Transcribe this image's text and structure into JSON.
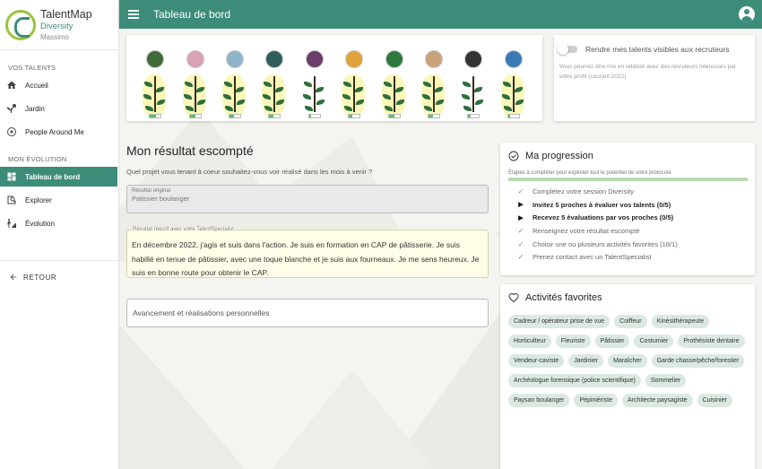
{
  "brand": {
    "name": "TalentMap",
    "sub": "Diversity",
    "user": "Massimo"
  },
  "sidebar": {
    "section1": "VOS TALENTS",
    "talents": [
      {
        "label": "Accueil",
        "icon": "home-icon"
      },
      {
        "label": "Jardin",
        "icon": "garden-icon"
      },
      {
        "label": "People Around Me",
        "icon": "target-icon"
      }
    ],
    "section2": "MON ÉVOLUTION",
    "evolution": [
      {
        "label": "Tableau de bord",
        "icon": "dashboard-icon",
        "active": true
      },
      {
        "label": "Explorer",
        "icon": "explore-icon"
      },
      {
        "label": "Évolution",
        "icon": "evolution-icon"
      }
    ],
    "back": "RETOUR"
  },
  "topbar": {
    "title": "Tableau de bord"
  },
  "colors": {
    "primary": "#3d8c7a",
    "chip": "#dbe9e2",
    "check": "#5aa55a"
  },
  "plants": [
    {
      "icon": "leaf-badge",
      "color": "#3f6a3a",
      "level": 0.6
    },
    {
      "icon": "flower-badge",
      "color": "#d9a3b3",
      "level": 0.5
    },
    {
      "icon": "cube-badge",
      "color": "#8fb3c9",
      "level": 0.4
    },
    {
      "icon": "flask-badge",
      "color": "#2f5d5a",
      "level": 0.4
    },
    {
      "icon": "music-badge",
      "color": "#6a3d6a",
      "level": 0.2
    },
    {
      "icon": "people-badge",
      "color": "#e0a23a",
      "level": 0.3
    },
    {
      "icon": "pi-badge",
      "color": "#2e7a3e",
      "level": 0.5
    },
    {
      "icon": "hand-badge",
      "color": "#c9a27a",
      "level": 0.4
    },
    {
      "icon": "piano-badge",
      "color": "#333333",
      "level": 0.2
    },
    {
      "icon": "person-badge",
      "color": "#3a7ab5",
      "level": 0.2
    }
  ],
  "visibility": {
    "label": "Rendre mes talents visibles aux recruteurs",
    "desc": "Vous pourrez être mis en relation avec des recruteurs intéressés par votre profil (courant 2022)"
  },
  "result": {
    "title": "Mon résultat escompté",
    "question": "Quel projet vous tenant à coeur souhaitez-vous voir réalisé dans les mois à venir ?",
    "original_label": "Résultat original",
    "original_value": "Patissier boulanger",
    "rewrite_label": "Résultat réécrit avec votre TalentSpecialist",
    "rewrite_value": "En décembre 2022, j'agis et suis dans l'action. Je suis en formation en CAP de pâtisserie. Je suis habillé en tenue de pâtissier, avec une toque blanche et je suis aux fourneaux. Je me sens heureux. Je suis en bonne route pour obtenir le CAP.",
    "progress_placeholder": "Avancement et réalisations personnelles"
  },
  "progression": {
    "title": "Ma progression",
    "subtitle": "Étapes à compléter pour exploiter tout le potentiel de votre protocole",
    "steps": [
      {
        "label": "Complétez votre session Diversity",
        "status": "done"
      },
      {
        "label": "Invitez 5 proches à évaluer vos talents (0/5)",
        "status": "todo"
      },
      {
        "label": "Recevez 5 évaluations par vos proches (0/5)",
        "status": "todo"
      },
      {
        "label": "Renseignez votre résultat escompté",
        "status": "done"
      },
      {
        "label": "Choisir une ou plusieurs activités favorites (18/1)",
        "status": "done"
      },
      {
        "label": "Prenez contact avec un TalentSpecialist",
        "status": "done"
      }
    ]
  },
  "favorites": {
    "title": "Activités favorites",
    "chips": [
      "Cadreur / opérateur prise de vue",
      "Coiffeur",
      "Kinésithérapeute",
      "Horticulteur",
      "Fleuriste",
      "Pâtissier",
      "Costumier",
      "Prothésiste dentaire",
      "Vendeur-caviste",
      "Jardinier",
      "Maraîcher",
      "Garde chasse/pêche/forestier",
      "Archéologue forensique (police scientifique)",
      "Sommelier",
      "Paysan boulanger",
      "Pépiniériste",
      "Architecte paysagiste",
      "Cuisinier"
    ]
  }
}
